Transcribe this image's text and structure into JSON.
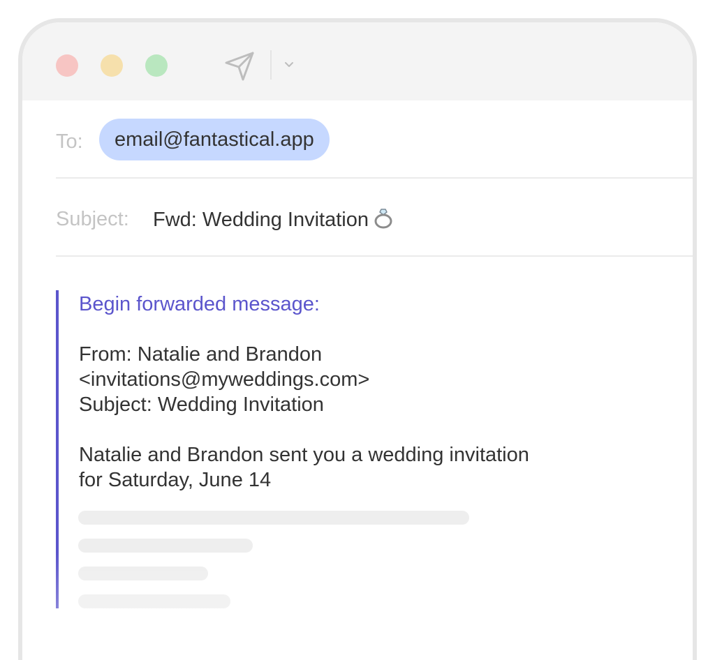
{
  "window": {
    "title_icons": [
      "close-button",
      "minimize-button",
      "maximize-button",
      "send-icon",
      "chevron-down-icon"
    ]
  },
  "compose": {
    "to_label": "To:",
    "to_recipient": "email@fantastical.app",
    "subject_label": "Subject:",
    "subject_value": "Fwd: Wedding Invitation",
    "subject_icon": "ring-icon"
  },
  "message": {
    "forward_heading": "Begin forwarded message:",
    "from_line": "From: Natalie and Brandon",
    "from_address": "<invitations@myweddings.com>",
    "subject_line": "Subject: Wedding Invitation",
    "body_line1": "Natalie and Brandon sent you a wedding invitation",
    "body_line2": "for Saturday, June 14"
  },
  "colors": {
    "accent": "#5b55cc",
    "chip_background": "#c6d8ff",
    "close": "#f7c5c3",
    "minimize": "#f6e0ac",
    "maximize": "#b9e7bf"
  }
}
